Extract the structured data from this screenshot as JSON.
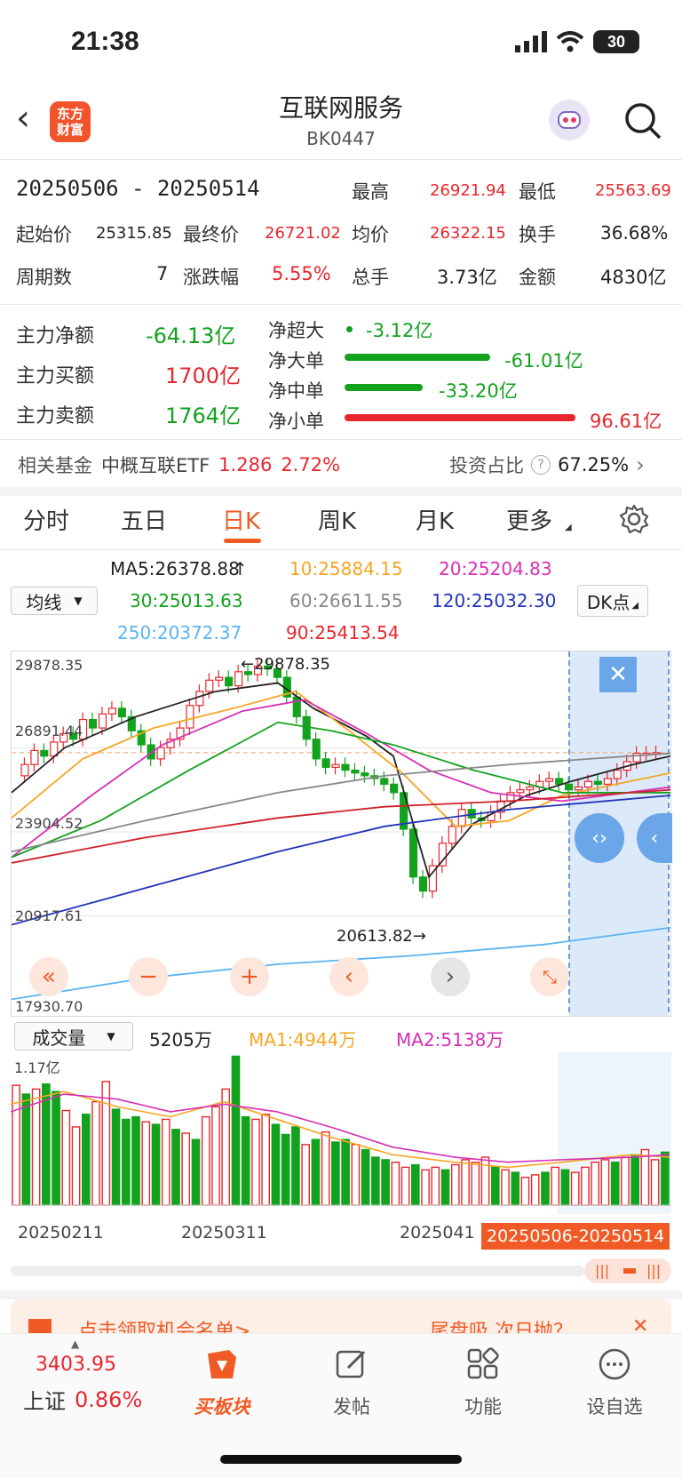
{
  "status": {
    "time": "21:38",
    "battery": "30"
  },
  "header": {
    "title": "互联网服务",
    "code": "BK0447",
    "logo_line1": "东方",
    "logo_line2": "财富"
  },
  "range": {
    "text": "20250506 - 20250514"
  },
  "stats": {
    "high_label": "最高",
    "high": "26921.94",
    "low_label": "最低",
    "low": "25563.69",
    "open_label": "起始价",
    "open": "25315.85",
    "close_label": "最终价",
    "close": "26721.02",
    "avg_label": "均价",
    "avg": "26322.15",
    "turnover_label": "换手",
    "turnover": "36.68%",
    "days_label": "周期数",
    "days": "7",
    "change_label": "涨跌幅",
    "change": "5.55%",
    "hands_label": "总手",
    "hands": "3.73亿",
    "amount_label": "金额",
    "amount": "4830亿"
  },
  "flow": {
    "net_label": "主力净额",
    "net": "-64.13亿",
    "buy_label": "主力买额",
    "buy": "1700亿",
    "sell_label": "主力卖额",
    "sell": "1764亿",
    "super_label": "净超大",
    "super": "-3.12亿",
    "large_label": "净大单",
    "large": "-61.01亿",
    "mid_label": "净中单",
    "mid": "-33.20亿",
    "small_label": "净小单",
    "small": "96.61亿",
    "large_fraction": 0.63,
    "mid_fraction": 0.34,
    "small_fraction": 1.0
  },
  "fund": {
    "label": "相关基金",
    "name": "中概互联ETF",
    "price": "1.286",
    "change": "2.72%",
    "ratio_label": "投资占比",
    "ratio": "67.25%"
  },
  "tabs": [
    "分时",
    "五日",
    "日K",
    "周K",
    "月K",
    "更多"
  ],
  "ma": {
    "ma5": "MA5:26378.88",
    "ma10": "10:25884.15",
    "ma20": "20:25204.83",
    "ma30": "30:25013.63",
    "ma60": "60:26611.55",
    "ma120": "120:25032.30",
    "ma250": "250:20372.37",
    "ma90": "90:25413.54",
    "select": "均线",
    "dk": "DK点"
  },
  "kchart": {
    "y_labels": [
      "29878.35",
      "26891.44",
      "23904.52",
      "20917.61",
      "17930.70"
    ],
    "max_tag": "←29878.35",
    "min_tag": "20613.82→"
  },
  "volume": {
    "select": "成交量",
    "value": "5205万",
    "ma1": "MA1:4944万",
    "ma2": "MA2:5138万",
    "top_label": "1.17亿",
    "dates": [
      "20250211",
      "20250311",
      "2025041"
    ],
    "range_tag": "20250506-20250514"
  },
  "banner": {
    "text": "点击领取机会名单>",
    "right": "尾盘吸   次日抛？"
  },
  "bottom": {
    "index_value": "3403.95",
    "index_name": "上证",
    "index_change": "0.86%",
    "nav": [
      "买板块",
      "发帖",
      "功能",
      "设自选"
    ]
  },
  "colors": {
    "up": "#e8262d",
    "down": "#12a21e",
    "accent": "#f05a24"
  }
}
